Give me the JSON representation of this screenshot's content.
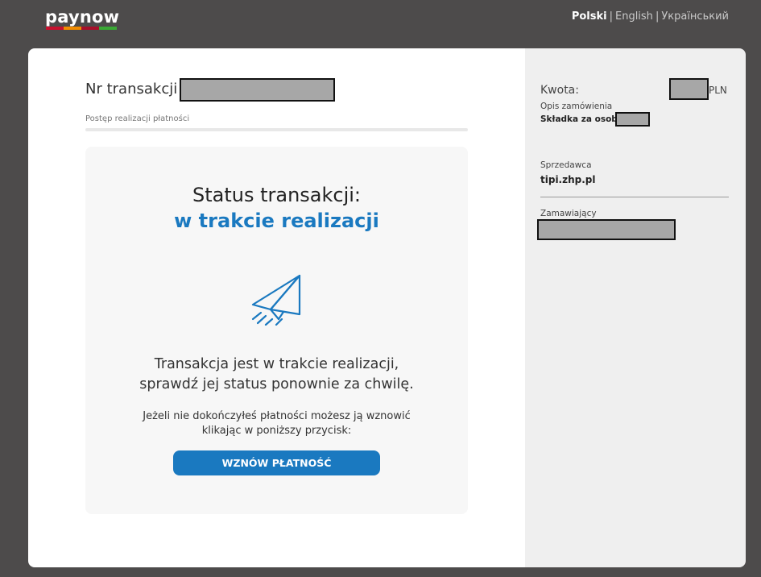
{
  "header": {
    "logo_text": "paynow",
    "logo_colors": [
      "#c8102e",
      "#f28c00",
      "#a8102a",
      "#3aa935"
    ],
    "languages": [
      {
        "label": "Polski",
        "active": true
      },
      {
        "label": "English",
        "active": false
      },
      {
        "label": "Український",
        "active": false
      }
    ],
    "separator": "|"
  },
  "transaction": {
    "nr_label": "Nr transakcji",
    "nr_value_redacted": true,
    "progress_label": "Postęp realizacji płatności"
  },
  "status": {
    "title": "Status transakcji:",
    "value": "w trakcie realizacji",
    "icon": "paper-plane-icon",
    "message_line1": "Transakcja jest w trakcie realizacji,",
    "message_line2": "sprawdź jej status ponownie za chwilę.",
    "sub_line1": "Jeżeli nie dokończyłeś płatności możesz ją wznowić",
    "sub_line2": "klikając w poniższy przycisk:",
    "button_label": "WZNÓW PŁATNOŚĆ"
  },
  "summary": {
    "kwota_label": "Kwota:",
    "currency": "PLN",
    "opis_label": "Opis zamówienia",
    "skladka_label": "Składka za osoby:",
    "sprzedawca_label": "Sprzedawca",
    "sprzedawca_value": "tipi.zhp.pl",
    "zamawiajacy_label": "Zamawiający"
  },
  "colors": {
    "accent": "#1a79c0",
    "background": "#4d4b4b",
    "redaction": "#a7a7a7"
  }
}
